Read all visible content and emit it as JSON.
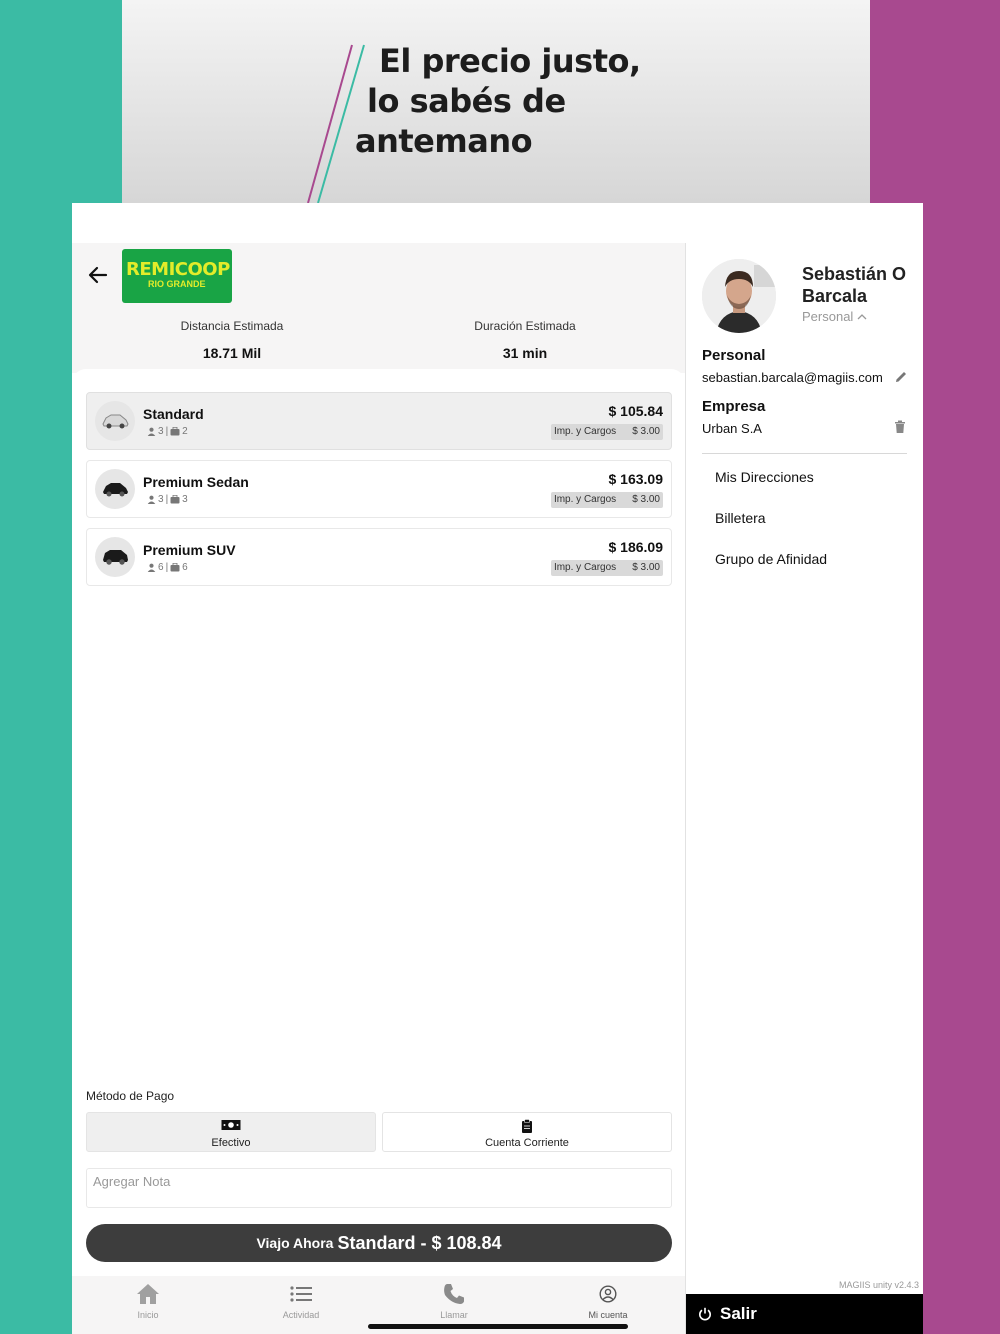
{
  "banner": {
    "line1": "El precio justo,",
    "line2": "lo sabés de",
    "line3": "antemano"
  },
  "brand": {
    "logo_main": "REMICOOP",
    "logo_sub": "RIO GRANDE"
  },
  "trip": {
    "distance_label": "Distancia Estimada",
    "distance_value": "18.71 Mil",
    "duration_label": "Duración Estimada",
    "duration_value": "31 min"
  },
  "vehicles": [
    {
      "name": "Standard",
      "passengers": "3",
      "luggage": "2",
      "price": "$ 105.84",
      "tax_label": "Imp. y Cargos",
      "tax_value": "$ 3.00",
      "selected": true
    },
    {
      "name": "Premium Sedan",
      "passengers": "3",
      "luggage": "3",
      "price": "$ 163.09",
      "tax_label": "Imp. y Cargos",
      "tax_value": "$ 3.00",
      "selected": false
    },
    {
      "name": "Premium SUV",
      "passengers": "6",
      "luggage": "6",
      "price": "$ 186.09",
      "tax_label": "Imp. y Cargos",
      "tax_value": "$ 3.00",
      "selected": false
    }
  ],
  "payment": {
    "label": "Método de Pago",
    "options": [
      "Efectivo",
      "Cuenta Corriente"
    ],
    "selected": "Efectivo",
    "note_placeholder": "Agregar Nota"
  },
  "cta": {
    "prefix": "Viajo Ahora",
    "main": "Standard - $ 108.84"
  },
  "tabs": [
    {
      "label": "Inicio",
      "icon": "home-icon"
    },
    {
      "label": "Actividad",
      "icon": "list-icon"
    },
    {
      "label": "Llamar",
      "icon": "phone-icon"
    },
    {
      "label": "Mi cuenta",
      "icon": "account-icon"
    }
  ],
  "profile": {
    "name": "Sebastián O Barcala",
    "role": "Personal",
    "personal_title": "Personal",
    "personal_email": "sebastian.barcala@magiis.com",
    "company_title": "Empresa",
    "company_name": "Urban S.A",
    "menu": [
      "Mis Direcciones",
      "Billetera",
      "Grupo de Afinidad"
    ],
    "version": "MAGIIS unity v2.4.3",
    "logout": "Salir"
  },
  "colors": {
    "teal": "#3bbba4",
    "magenta": "#a8498f",
    "logo_green": "#19a445",
    "logo_yellow": "#e3ec2a",
    "cta_dark": "#3d3d3d"
  }
}
